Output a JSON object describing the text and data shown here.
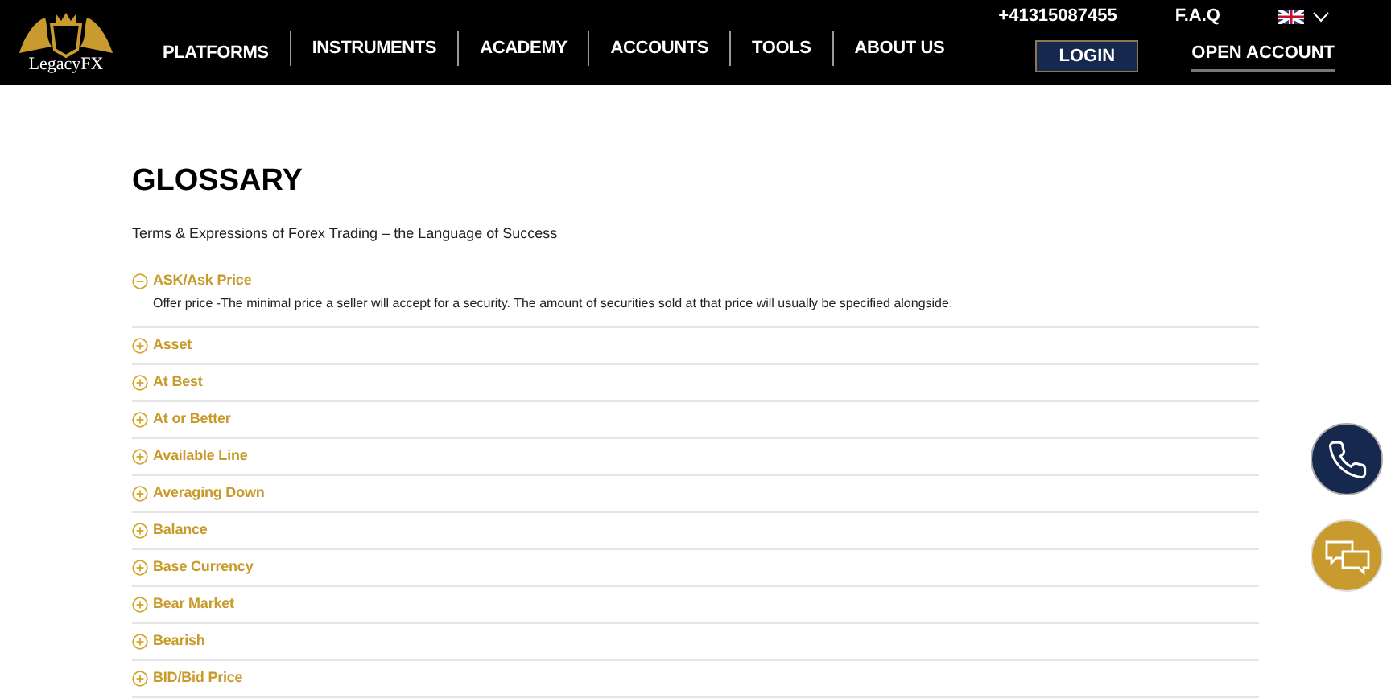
{
  "header": {
    "logo_text": "LegacyFX",
    "nav": [
      "PLATFORMS",
      "INSTRUMENTS",
      "ACADEMY",
      "ACCOUNTS",
      "TOOLS",
      "ABOUT US"
    ],
    "phone": "+41315087455",
    "faq": "F.A.Q",
    "login": "LOGIN",
    "open_account": "OPEN ACCOUNT"
  },
  "page": {
    "title": "GLOSSARY",
    "subtitle": "Terms & Expressions of Forex Trading – the Language of Success",
    "terms": [
      {
        "term": "ASK/Ask Price",
        "expanded": true,
        "definition": "Offer price -The minimal price a seller will accept for a security. The amount of securities sold at that price will usually be specified alongside."
      },
      {
        "term": "Asset",
        "expanded": false
      },
      {
        "term": "At Best",
        "expanded": false
      },
      {
        "term": "At or Better",
        "expanded": false
      },
      {
        "term": "Available Line",
        "expanded": false
      },
      {
        "term": "Averaging Down",
        "expanded": false
      },
      {
        "term": "Balance",
        "expanded": false
      },
      {
        "term": "Base Currency",
        "expanded": false
      },
      {
        "term": "Bear Market",
        "expanded": false
      },
      {
        "term": "Bearish",
        "expanded": false
      },
      {
        "term": "BID/Bid Price",
        "expanded": false
      }
    ]
  }
}
